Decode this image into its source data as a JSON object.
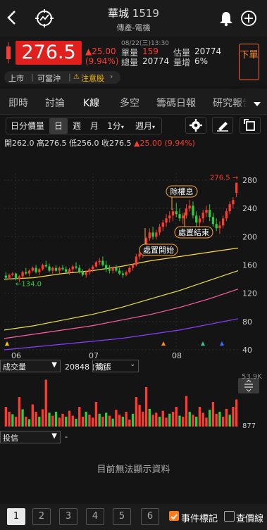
{
  "header": {
    "stock_name": "華城",
    "stock_code": "1519",
    "industry": "傳產-電機",
    "back_icon": "chevron-left",
    "radar_icon": "radar-chart",
    "alert_icon": "bell",
    "add_icon": "plus-circle"
  },
  "quote": {
    "price": "276.5",
    "change": "▲25.00",
    "change_pct": "(9.94%)",
    "timestamp": "08/22(三)13:30",
    "unit_volume_label": "單量",
    "unit_volume": "159",
    "total_volume_label": "總量",
    "total_volume": "20774",
    "est_volume_label": "估量",
    "est_volume": "20774",
    "volume_increase_label": "量增",
    "volume_increase": "6%",
    "sell_button": "下單",
    "tags": [
      "上市",
      "可當沖",
      "注意股"
    ],
    "colors": {
      "up": "#ff3b30",
      "down": "#2ecc40",
      "price_bg": "#e0201d"
    }
  },
  "tabs": [
    "即時",
    "討論",
    "K線",
    "多空",
    "籌碼日報",
    "研究報告"
  ],
  "active_tab": "K線",
  "periods": {
    "items": [
      "日分價量",
      "日",
      "週",
      "月",
      "1分",
      "週月"
    ],
    "selected": "日"
  },
  "ohlc": {
    "open_label": "開",
    "open": "262.0",
    "high_label": "高",
    "high": "276.5",
    "low_label": "低",
    "low": "256.0",
    "close_label": "收",
    "close": "276.5",
    "change": "▲25.00 (9.94%)"
  },
  "chart_data": {
    "type": "candlestick",
    "y_ticks": [
      "280",
      "240",
      "200",
      "160",
      "120",
      "80",
      "40"
    ],
    "ylim": [
      40,
      290
    ],
    "x_ticks": [
      "06",
      "07",
      "08"
    ],
    "last_price_label": "276.5",
    "low_label": "134.0",
    "annotations": [
      "除權息",
      "處置結束",
      "處置開始"
    ],
    "candles": [
      [
        145,
        150,
        138,
        142
      ],
      [
        142,
        148,
        140,
        146
      ],
      [
        146,
        150,
        144,
        148
      ],
      [
        148,
        149,
        138,
        140
      ],
      [
        140,
        146,
        136,
        144
      ],
      [
        144,
        152,
        142,
        150
      ],
      [
        150,
        156,
        146,
        148
      ],
      [
        148,
        154,
        144,
        152
      ],
      [
        152,
        158,
        150,
        156
      ],
      [
        156,
        160,
        148,
        150
      ],
      [
        150,
        156,
        146,
        154
      ],
      [
        154,
        162,
        152,
        160
      ],
      [
        160,
        166,
        156,
        158
      ],
      [
        158,
        162,
        150,
        152
      ],
      [
        152,
        158,
        148,
        156
      ],
      [
        156,
        160,
        150,
        152
      ],
      [
        152,
        158,
        148,
        156
      ],
      [
        156,
        160,
        152,
        154
      ],
      [
        154,
        158,
        148,
        150
      ],
      [
        150,
        156,
        146,
        154
      ],
      [
        154,
        160,
        150,
        158
      ],
      [
        158,
        164,
        154,
        156
      ],
      [
        156,
        160,
        148,
        150
      ],
      [
        150,
        154,
        144,
        146
      ],
      [
        146,
        152,
        142,
        150
      ],
      [
        150,
        156,
        146,
        154
      ],
      [
        154,
        160,
        150,
        158
      ],
      [
        158,
        166,
        156,
        164
      ],
      [
        164,
        170,
        160,
        166
      ],
      [
        166,
        172,
        158,
        160
      ],
      [
        160,
        166,
        150,
        154
      ],
      [
        154,
        160,
        148,
        152
      ],
      [
        152,
        158,
        148,
        156
      ],
      [
        156,
        160,
        150,
        152
      ],
      [
        152,
        156,
        146,
        148
      ],
      [
        148,
        152,
        142,
        146
      ],
      [
        146,
        152,
        144,
        150
      ],
      [
        150,
        158,
        148,
        156
      ],
      [
        156,
        162,
        152,
        160
      ],
      [
        160,
        176,
        158,
        172
      ],
      [
        172,
        182,
        168,
        176
      ],
      [
        176,
        186,
        170,
        182
      ],
      [
        182,
        200,
        180,
        198
      ],
      [
        198,
        212,
        194,
        206
      ],
      [
        206,
        214,
        196,
        200
      ],
      [
        200,
        210,
        196,
        206
      ],
      [
        206,
        218,
        202,
        214
      ],
      [
        214,
        224,
        208,
        220
      ],
      [
        220,
        232,
        214,
        226
      ],
      [
        226,
        236,
        220,
        230
      ],
      [
        230,
        240,
        222,
        236
      ],
      [
        236,
        248,
        228,
        232
      ],
      [
        232,
        240,
        222,
        226
      ],
      [
        226,
        234,
        218,
        230
      ],
      [
        230,
        246,
        226,
        240
      ],
      [
        240,
        252,
        236,
        244
      ],
      [
        244,
        250,
        226,
        230
      ],
      [
        230,
        236,
        214,
        220
      ],
      [
        220,
        230,
        212,
        226
      ],
      [
        226,
        238,
        220,
        234
      ],
      [
        234,
        244,
        228,
        238
      ],
      [
        238,
        246,
        222,
        228
      ],
      [
        228,
        234,
        214,
        218
      ],
      [
        218,
        226,
        208,
        212
      ],
      [
        212,
        222,
        204,
        216
      ],
      [
        216,
        230,
        212,
        226
      ],
      [
        226,
        240,
        222,
        236
      ],
      [
        236,
        250,
        232,
        246
      ],
      [
        246,
        256,
        240,
        252
      ],
      [
        262,
        276.5,
        256,
        276.5
      ]
    ],
    "ma_series": [
      {
        "color": "#ffd84a",
        "values": [
          140,
          142,
          148,
          152,
          158,
          166,
          172,
          178,
          184
        ]
      },
      {
        "color": "#e8e04a",
        "values": [
          68,
          74,
          82,
          90,
          100,
          112,
          124,
          138,
          152
        ]
      },
      {
        "color": "#ff5fa2",
        "values": [
          56,
          62,
          68,
          74,
          82,
          90,
          100,
          112,
          126
        ]
      },
      {
        "color": "#8a3cff",
        "values": [
          40,
          44,
          48,
          52,
          56,
          62,
          68,
          76,
          84
        ]
      }
    ],
    "volume_max": "53.9K",
    "volume_min": "877",
    "volumes": [
      [
        40,
        1
      ],
      [
        30,
        1
      ],
      [
        25,
        0
      ],
      [
        20,
        1
      ],
      [
        60,
        1
      ],
      [
        35,
        0
      ],
      [
        20,
        1
      ],
      [
        15,
        0
      ],
      [
        45,
        1
      ],
      [
        30,
        1
      ],
      [
        20,
        0
      ],
      [
        35,
        1
      ],
      [
        95,
        1
      ],
      [
        28,
        0
      ],
      [
        22,
        1
      ],
      [
        30,
        0
      ],
      [
        18,
        1
      ],
      [
        26,
        1
      ],
      [
        20,
        0
      ],
      [
        32,
        1
      ],
      [
        22,
        1
      ],
      [
        16,
        0
      ],
      [
        40,
        1
      ],
      [
        20,
        1
      ],
      [
        30,
        0
      ],
      [
        24,
        1
      ],
      [
        18,
        1
      ],
      [
        50,
        1
      ],
      [
        26,
        0
      ],
      [
        20,
        1
      ],
      [
        28,
        0
      ],
      [
        22,
        1
      ],
      [
        16,
        0
      ],
      [
        34,
        1
      ],
      [
        24,
        1
      ],
      [
        20,
        0
      ],
      [
        30,
        1
      ],
      [
        14,
        1
      ],
      [
        26,
        0
      ],
      [
        60,
        1
      ],
      [
        44,
        1
      ],
      [
        30,
        1
      ],
      [
        80,
        1
      ],
      [
        36,
        0
      ],
      [
        24,
        1
      ],
      [
        28,
        1
      ],
      [
        20,
        0
      ],
      [
        32,
        1
      ],
      [
        18,
        1
      ],
      [
        26,
        0
      ],
      [
        30,
        1
      ],
      [
        40,
        1
      ],
      [
        22,
        0
      ],
      [
        20,
        1
      ],
      [
        62,
        1
      ],
      [
        30,
        0
      ],
      [
        24,
        1
      ],
      [
        20,
        0
      ],
      [
        40,
        1
      ],
      [
        28,
        1
      ],
      [
        18,
        1
      ],
      [
        34,
        0
      ],
      [
        50,
        1
      ],
      [
        26,
        1
      ],
      [
        30,
        0
      ],
      [
        20,
        1
      ],
      [
        36,
        1
      ],
      [
        24,
        0
      ],
      [
        40,
        1
      ],
      [
        55,
        1
      ]
    ]
  },
  "volume_panel": {
    "indicator": "成交量",
    "value": "20848 (張)",
    "unit_select": "均張"
  },
  "investor_panel": {
    "indicator": "投信",
    "value": "-",
    "no_data": "目前無法顯示資料"
  },
  "bottom": {
    "pages": [
      "1",
      "2",
      "3",
      "4",
      "5",
      "6"
    ],
    "event_mark": "事件標記",
    "query_line": "查價線"
  }
}
